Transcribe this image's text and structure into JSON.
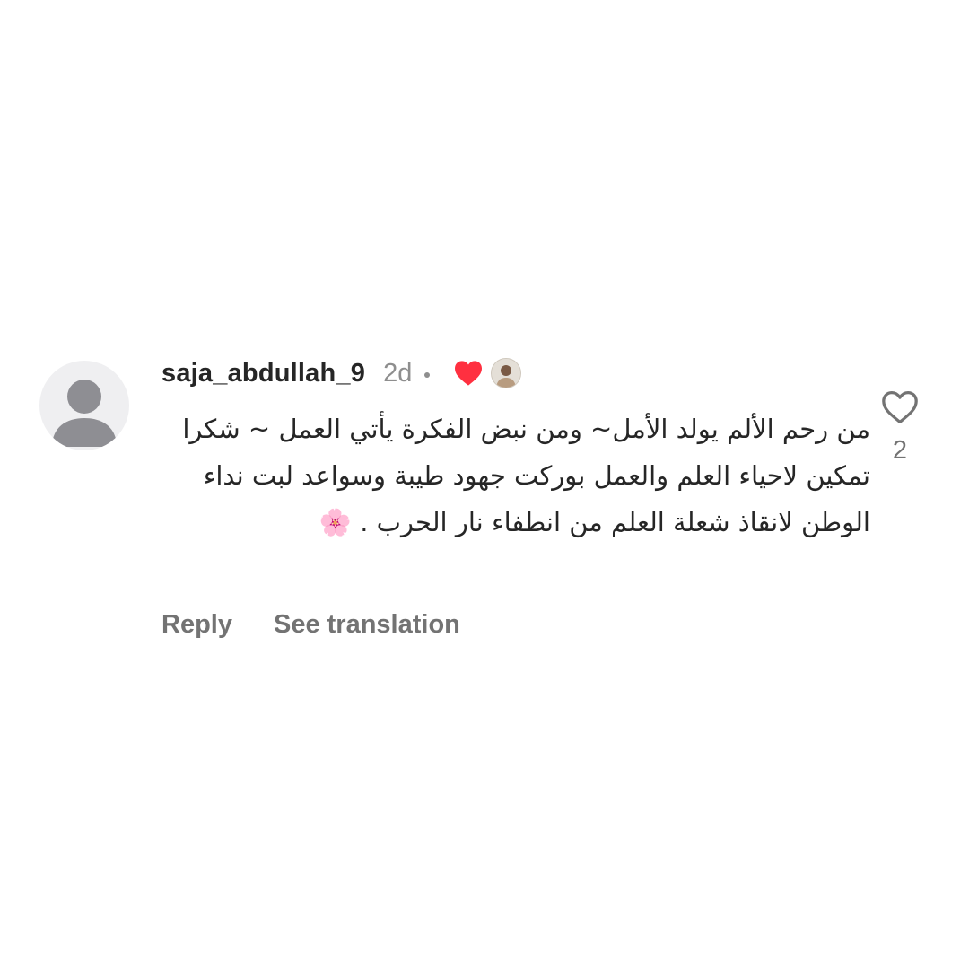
{
  "comment": {
    "username": "saja_abdullah_9",
    "time": "2d",
    "text": "من رحم الألم يولد الأمل~ ومن نبض الفكرة يأتي العمل ~ شكرا  تمكين لاحياء العلم والعمل بوركت جهود طيبة وسواعد  لبت نداء الوطن لانقاذ شعلة العلم من انطفاء نار الحرب . 🌸",
    "reply_label": "Reply",
    "translate_label": "See translation",
    "like_count": "2",
    "liked_by_creator": true
  },
  "icons": {
    "avatar": "default-avatar-icon",
    "liked_heart": "filled-heart-icon",
    "like": "heart-outline-icon"
  },
  "colors": {
    "liked_heart": "#ff3040",
    "text": "#262626",
    "muted": "#8e8e8e"
  }
}
